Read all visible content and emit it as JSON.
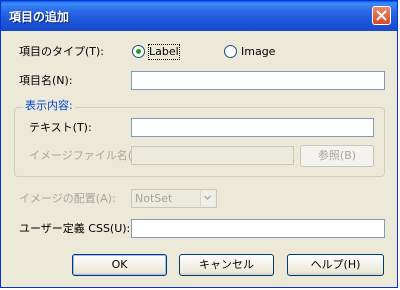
{
  "window": {
    "title": "項目の追加"
  },
  "item_type": {
    "label": "項目のタイプ(T):",
    "option_label": "Label",
    "option_image": "Image",
    "selected": "Label"
  },
  "item_name": {
    "label": "項目名(N):",
    "value": ""
  },
  "display_group": {
    "legend": "表示内容:",
    "text_label": "テキスト(T):",
    "text_value": "",
    "image_file_label": "イメージファイル名(I):",
    "image_file_value": "",
    "browse_label": "参照(B)"
  },
  "image_placement": {
    "label": "イメージの配置(A):",
    "value": "NotSet"
  },
  "user_css": {
    "label": "ユーザー定義 CSS(U):",
    "value": ""
  },
  "buttons": {
    "ok": "OK",
    "cancel": "キャンセル",
    "help": "ヘルプ(H)"
  }
}
